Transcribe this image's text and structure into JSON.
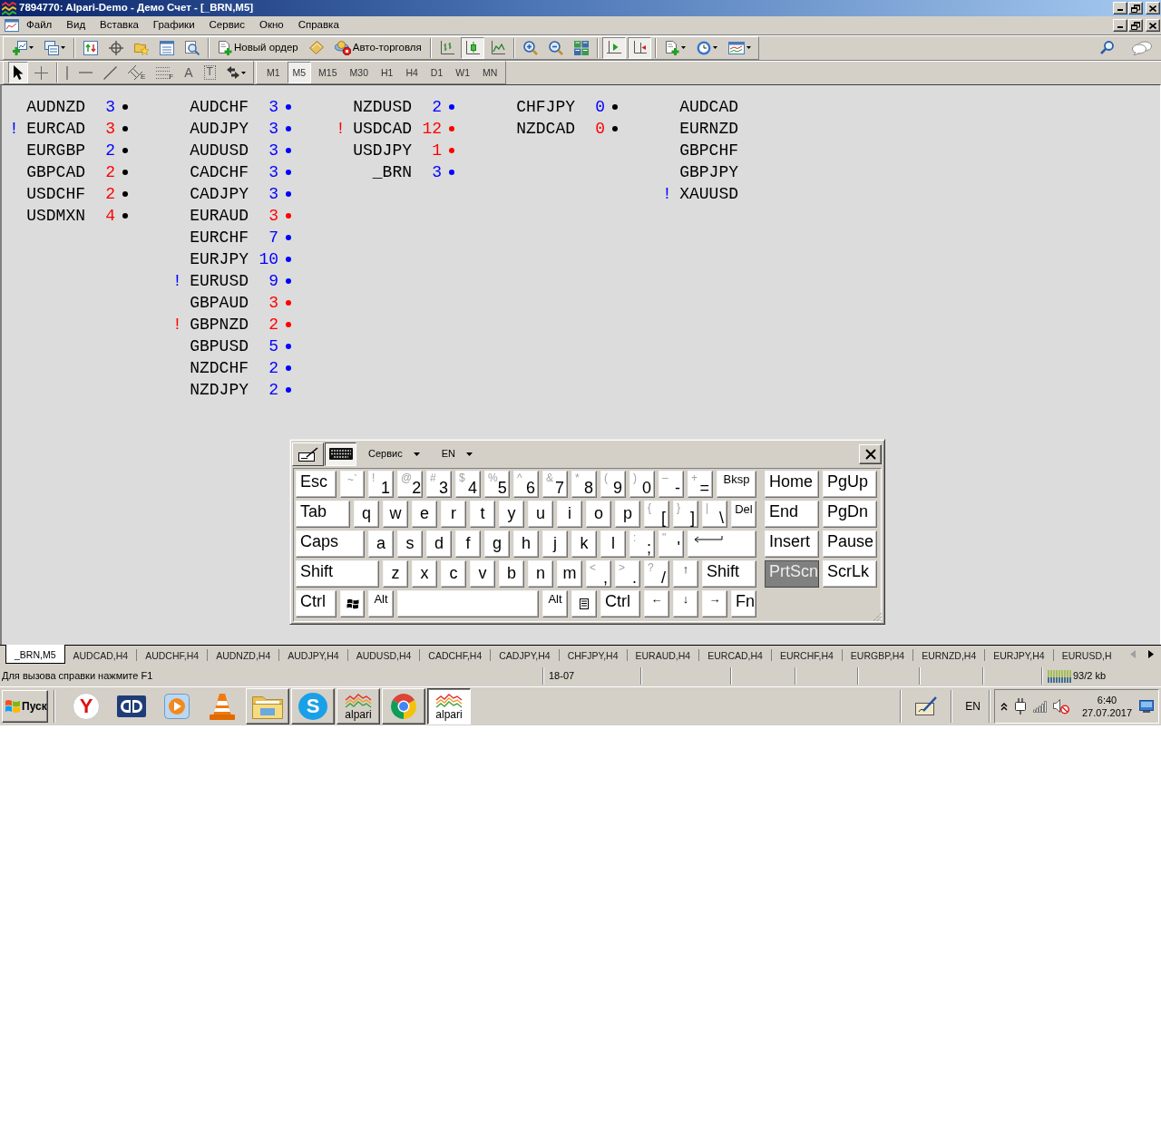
{
  "window": {
    "title": "7894770: Alpari-Demo - Демо Счет - [_BRN,M5]"
  },
  "menu": [
    "Файл",
    "Вид",
    "Вставка",
    "Графики",
    "Сервис",
    "Окно",
    "Справка"
  ],
  "toolbar": {
    "groups": [
      [
        {
          "kind": "new-chart",
          "menu": true,
          "pressed": false
        },
        {
          "kind": "profiles",
          "menu": true,
          "pressed": false
        }
      ],
      [
        {
          "kind": "market-watch",
          "pressed": false
        },
        {
          "kind": "data-window",
          "pressed": false
        },
        {
          "kind": "navigator",
          "pressed": false
        },
        {
          "kind": "terminal",
          "pressed": false
        },
        {
          "kind": "tester",
          "pressed": false
        }
      ],
      [
        {
          "kind": "order",
          "label": "Новый ордер",
          "pressed": false
        },
        {
          "kind": "editor",
          "pressed": false
        },
        {
          "kind": "autotrade",
          "label": "Авто-торговля",
          "pressed": false
        }
      ],
      [
        {
          "kind": "bars",
          "pressed": false
        },
        {
          "kind": "candles",
          "pressed": true
        },
        {
          "kind": "line",
          "pressed": false
        }
      ],
      [
        {
          "kind": "zoom-in",
          "pressed": false
        },
        {
          "kind": "zoom-out",
          "pressed": false
        },
        {
          "kind": "tile",
          "pressed": false
        }
      ],
      [
        {
          "kind": "autoscroll",
          "pressed": true
        },
        {
          "kind": "shift",
          "pressed": true
        }
      ],
      [
        {
          "kind": "indicators",
          "menu": true,
          "pressed": false
        },
        {
          "kind": "periods",
          "menu": true,
          "pressed": false
        },
        {
          "kind": "templates",
          "menu": true,
          "pressed": false
        }
      ]
    ],
    "right": [
      {
        "kind": "search",
        "pressed": false
      },
      {
        "kind": "chat",
        "pressed": false
      }
    ]
  },
  "drawing_tools": {
    "groups": [
      [
        {
          "kind": "cursor",
          "pressed": true
        },
        {
          "kind": "crosshair",
          "pressed": false
        }
      ],
      [
        {
          "kind": "vline",
          "pressed": false
        },
        {
          "kind": "hline",
          "pressed": false
        },
        {
          "kind": "trend",
          "pressed": false
        },
        {
          "kind": "channel",
          "sub": "E",
          "pressed": false
        },
        {
          "kind": "fibo",
          "sub": "F",
          "pressed": false
        },
        {
          "kind": "text",
          "glyph": "A",
          "pressed": false
        },
        {
          "kind": "label",
          "glyph": "T",
          "pressed": false
        },
        {
          "kind": "arrows",
          "menu": true,
          "pressed": false
        }
      ]
    ]
  },
  "timeframes": [
    {
      "label": "M1",
      "selected": false
    },
    {
      "label": "M5",
      "selected": true
    },
    {
      "label": "M15",
      "selected": false
    },
    {
      "label": "M30",
      "selected": false
    },
    {
      "label": "H1",
      "selected": false
    },
    {
      "label": "H4",
      "selected": false
    },
    {
      "label": "D1",
      "selected": false
    },
    {
      "label": "W1",
      "selected": false
    },
    {
      "label": "MN",
      "selected": false
    }
  ],
  "chart": {
    "columns": [
      [
        {
          "symbol": "AUDNZD",
          "count": {
            "text": "3",
            "color": "#0000ff"
          },
          "dot": {
            "color": "#000000"
          }
        },
        {
          "flag": {
            "text": "!",
            "color": "#0000ff"
          },
          "symbol": "EURCAD",
          "count": {
            "text": "3",
            "color": "#ff0000"
          },
          "dot": {
            "color": "#000000"
          }
        },
        {
          "symbol": "EURGBP",
          "count": {
            "text": "2",
            "color": "#0000ff"
          },
          "dot": {
            "color": "#000000"
          }
        },
        {
          "symbol": "GBPCAD",
          "count": {
            "text": "2",
            "color": "#ff0000"
          },
          "dot": {
            "color": "#000000"
          }
        },
        {
          "symbol": "USDCHF",
          "count": {
            "text": "2",
            "color": "#ff0000"
          },
          "dot": {
            "color": "#000000"
          }
        },
        {
          "symbol": "USDMXN",
          "count": {
            "text": "4",
            "color": "#ff0000"
          },
          "dot": {
            "color": "#000000"
          }
        }
      ],
      [
        {
          "symbol": "AUDCHF",
          "count": {
            "text": "3",
            "color": "#0000ff"
          },
          "dot": {
            "color": "#0000ff"
          }
        },
        {
          "symbol": "AUDJPY",
          "count": {
            "text": "3",
            "color": "#0000ff"
          },
          "dot": {
            "color": "#0000ff"
          }
        },
        {
          "symbol": "AUDUSD",
          "count": {
            "text": "3",
            "color": "#0000ff"
          },
          "dot": {
            "color": "#0000ff"
          }
        },
        {
          "symbol": "CADCHF",
          "count": {
            "text": "3",
            "color": "#0000ff"
          },
          "dot": {
            "color": "#0000ff"
          }
        },
        {
          "symbol": "CADJPY",
          "count": {
            "text": "3",
            "color": "#0000ff"
          },
          "dot": {
            "color": "#0000ff"
          }
        },
        {
          "symbol": "EURAUD",
          "count": {
            "text": "3",
            "color": "#ff0000"
          },
          "dot": {
            "color": "#ff0000"
          }
        },
        {
          "symbol": "EURCHF",
          "count": {
            "text": "7",
            "color": "#0000ff"
          },
          "dot": {
            "color": "#0000ff"
          }
        },
        {
          "symbol": "EURJPY",
          "count": {
            "text": "10",
            "color": "#0000ff"
          },
          "dot": {
            "color": "#0000ff"
          }
        },
        {
          "flag": {
            "text": "!",
            "color": "#0000ff"
          },
          "symbol": "EURUSD",
          "count": {
            "text": "9",
            "color": "#0000ff"
          },
          "dot": {
            "color": "#0000ff"
          }
        },
        {
          "symbol": "GBPAUD",
          "count": {
            "text": "3",
            "color": "#ff0000"
          },
          "dot": {
            "color": "#ff0000"
          }
        },
        {
          "flag": {
            "text": "!",
            "color": "#ff0000"
          },
          "symbol": "GBPNZD",
          "count": {
            "text": "2",
            "color": "#ff0000"
          },
          "dot": {
            "color": "#ff0000"
          }
        },
        {
          "symbol": "GBPUSD",
          "count": {
            "text": "5",
            "color": "#0000ff"
          },
          "dot": {
            "color": "#0000ff"
          }
        },
        {
          "symbol": "NZDCHF",
          "count": {
            "text": "2",
            "color": "#0000ff"
          },
          "dot": {
            "color": "#0000ff"
          }
        },
        {
          "symbol": "NZDJPY",
          "count": {
            "text": "2",
            "color": "#0000ff"
          },
          "dot": {
            "color": "#0000ff"
          }
        }
      ],
      [
        {
          "symbol": "NZDUSD",
          "count": {
            "text": "2",
            "color": "#0000ff"
          },
          "dot": {
            "color": "#0000ff"
          }
        },
        {
          "flag": {
            "text": "!",
            "color": "#ff0000"
          },
          "symbol": "USDCAD",
          "count": {
            "text": "12",
            "color": "#ff0000"
          },
          "dot": {
            "color": "#ff0000"
          }
        },
        {
          "symbol": "USDJPY",
          "count": {
            "text": "1",
            "color": "#ff0000"
          },
          "dot": {
            "color": "#ff0000"
          }
        },
        {
          "symbol": "_BRN",
          "count": {
            "text": "3",
            "color": "#0000ff"
          },
          "dot": {
            "color": "#0000ff"
          }
        }
      ],
      [
        {
          "symbol": "CHFJPY",
          "count": {
            "text": "0",
            "color": "#0000ff"
          },
          "dot": {
            "color": "#000000"
          }
        },
        {
          "symbol": "NZDCAD",
          "count": {
            "text": "0",
            "color": "#ff0000"
          },
          "dot": {
            "color": "#000000"
          }
        }
      ],
      [
        {
          "symbol": "AUDCAD"
        },
        {
          "symbol": "EURNZD"
        },
        {
          "symbol": "GBPCHF"
        },
        {
          "symbol": "GBPJPY"
        },
        {
          "flag": {
            "text": "!",
            "color": "#0000ff"
          },
          "symbol": "XAUUSD"
        }
      ]
    ]
  },
  "keyboard": {
    "modes": [
      {
        "kind": "pen",
        "selected": false
      },
      {
        "kind": "keys",
        "selected": true
      }
    ],
    "menus": [
      {
        "label": "Сервис"
      },
      {
        "label": "EN"
      }
    ],
    "rows": [
      [
        {
          "kind": "name",
          "label": "Esc",
          "pressed": false
        },
        {
          "kind": "dim",
          "label": "~`",
          "pressed": false
        },
        {
          "kind": "dual",
          "shift": "!",
          "label": "1",
          "pressed": false
        },
        {
          "kind": "dual",
          "shift": "@",
          "label": "2",
          "pressed": false
        },
        {
          "kind": "dual",
          "shift": "#",
          "label": "3",
          "pressed": false
        },
        {
          "kind": "dual",
          "shift": "$",
          "label": "4",
          "pressed": false
        },
        {
          "kind": "dual",
          "shift": "%",
          "label": "5",
          "pressed": false
        },
        {
          "kind": "dual",
          "shift": "^",
          "label": "6",
          "pressed": false
        },
        {
          "kind": "dual",
          "shift": "&",
          "label": "7",
          "pressed": false
        },
        {
          "kind": "dual",
          "shift": "*",
          "label": "8",
          "pressed": false
        },
        {
          "kind": "dual",
          "shift": "(",
          "label": "9",
          "pressed": false
        },
        {
          "kind": "dual",
          "shift": ")",
          "label": "0",
          "pressed": false
        },
        {
          "kind": "dual",
          "shift": "–",
          "label": "-",
          "pressed": false
        },
        {
          "kind": "dual",
          "shift": "+",
          "label": "=",
          "pressed": false
        },
        {
          "kind": "mini",
          "label": "Bksp",
          "pressed": false
        },
        {
          "kind": "name",
          "label": "Home",
          "pressed": false
        },
        {
          "kind": "name",
          "label": "PgUp",
          "pressed": false
        }
      ],
      [
        {
          "kind": "name",
          "label": "Tab",
          "pressed": false
        },
        {
          "kind": "letter",
          "label": "q",
          "pressed": false
        },
        {
          "kind": "letter",
          "label": "w",
          "pressed": false
        },
        {
          "kind": "letter",
          "label": "e",
          "pressed": false
        },
        {
          "kind": "letter",
          "label": "r",
          "pressed": false
        },
        {
          "kind": "letter",
          "label": "t",
          "pressed": false
        },
        {
          "kind": "letter",
          "label": "y",
          "pressed": false
        },
        {
          "kind": "letter",
          "label": "u",
          "pressed": false
        },
        {
          "kind": "letter",
          "label": "i",
          "pressed": false
        },
        {
          "kind": "letter",
          "label": "o",
          "pressed": false
        },
        {
          "kind": "letter",
          "label": "p",
          "pressed": false
        },
        {
          "kind": "dual",
          "shift": "{",
          "label": "[",
          "pressed": false
        },
        {
          "kind": "dual",
          "shift": "}",
          "label": "]",
          "pressed": false
        },
        {
          "kind": "dual",
          "shift": "|",
          "label": "\\",
          "pressed": false
        },
        {
          "kind": "mini",
          "label": "Del",
          "pressed": false
        },
        {
          "kind": "name",
          "label": "End",
          "pressed": false
        },
        {
          "kind": "name",
          "label": "PgDn",
          "pressed": false
        }
      ],
      [
        {
          "kind": "name",
          "label": "Caps",
          "pressed": false
        },
        {
          "kind": "letter",
          "label": "a",
          "pressed": false
        },
        {
          "kind": "letter",
          "label": "s",
          "pressed": false
        },
        {
          "kind": "letter",
          "label": "d",
          "pressed": false
        },
        {
          "kind": "letter",
          "label": "f",
          "pressed": false
        },
        {
          "kind": "letter",
          "label": "g",
          "pressed": false
        },
        {
          "kind": "letter",
          "label": "h",
          "pressed": false
        },
        {
          "kind": "letter",
          "label": "j",
          "pressed": false
        },
        {
          "kind": "letter",
          "label": "k",
          "pressed": false
        },
        {
          "kind": "letter",
          "label": "l",
          "pressed": false
        },
        {
          "kind": "dual",
          "shift": ":",
          "label": ";",
          "pressed": false
        },
        {
          "kind": "dual",
          "shift": "\"",
          "label": "'",
          "pressed": false
        },
        {
          "kind": "enter",
          "pressed": false
        },
        {
          "kind": "name",
          "label": "Insert",
          "pressed": false
        },
        {
          "kind": "name",
          "label": "Pause",
          "pressed": false
        }
      ],
      [
        {
          "kind": "name",
          "label": "Shift",
          "pressed": false
        },
        {
          "kind": "letter",
          "label": "z",
          "pressed": false
        },
        {
          "kind": "letter",
          "label": "x",
          "pressed": false
        },
        {
          "kind": "letter",
          "label": "c",
          "pressed": false
        },
        {
          "kind": "letter",
          "label": "v",
          "pressed": false
        },
        {
          "kind": "letter",
          "label": "b",
          "pressed": false
        },
        {
          "kind": "letter",
          "label": "n",
          "pressed": false
        },
        {
          "kind": "letter",
          "label": "m",
          "pressed": false
        },
        {
          "kind": "dual",
          "shift": "<",
          "label": ",",
          "pressed": false
        },
        {
          "kind": "dual",
          "shift": ">",
          "label": ".",
          "pressed": false
        },
        {
          "kind": "dual",
          "shift": "?",
          "label": "/",
          "pressed": false
        },
        {
          "kind": "mini",
          "label": "↑",
          "pressed": false
        },
        {
          "kind": "name",
          "label": "Shift",
          "pressed": false
        },
        {
          "kind": "name",
          "label": "PrtScn",
          "pressed": true
        },
        {
          "kind": "name",
          "label": "ScrLk",
          "pressed": false
        }
      ],
      [
        {
          "kind": "name",
          "label": "Ctrl",
          "pressed": false
        },
        {
          "kind": "windows",
          "pressed": false
        },
        {
          "kind": "mini",
          "label": "Alt",
          "pressed": false
        },
        {
          "kind": "space",
          "pressed": false
        },
        {
          "kind": "mini",
          "label": "Alt",
          "pressed": false
        },
        {
          "kind": "menu",
          "pressed": false
        },
        {
          "kind": "name",
          "label": "Ctrl",
          "pressed": false
        },
        {
          "kind": "mini",
          "label": "←",
          "pressed": false
        },
        {
          "kind": "mini",
          "label": "↓",
          "pressed": false
        },
        {
          "kind": "mini",
          "label": "→",
          "pressed": false
        },
        {
          "kind": "name",
          "label": "Fn",
          "pressed": false
        }
      ]
    ]
  },
  "tabs": [
    {
      "label": "_BRN,M5",
      "selected": true
    },
    {
      "label": "AUDCAD,H4",
      "selected": false
    },
    {
      "label": "AUDCHF,H4",
      "selected": false
    },
    {
      "label": "AUDNZD,H4",
      "selected": false
    },
    {
      "label": "AUDJPY,H4",
      "selected": false
    },
    {
      "label": "AUDUSD,H4",
      "selected": false
    },
    {
      "label": "CADCHF,H4",
      "selected": false
    },
    {
      "label": "CADJPY,H4",
      "selected": false
    },
    {
      "label": "CHFJPY,H4",
      "selected": false
    },
    {
      "label": "EURAUD,H4",
      "selected": false
    },
    {
      "label": "EURCAD,H4",
      "selected": false
    },
    {
      "label": "EURCHF,H4",
      "selected": false
    },
    {
      "label": "EURGBP,H4",
      "selected": false
    },
    {
      "label": "EURNZD,H4",
      "selected": false
    },
    {
      "label": "EURJPY,H4",
      "selected": false
    },
    {
      "label": "EURUSD,H",
      "selected": false
    }
  ],
  "tab_scroll": [
    {
      "kind": "left",
      "disabled": true
    },
    {
      "kind": "right",
      "disabled": false
    }
  ],
  "status_bar": {
    "help": "Для вызова справки нажмите F1",
    "panels": [
      "18-07"
    ],
    "traffic": "93/2 kb"
  },
  "taskbar": {
    "start": "Пуск",
    "apps": [
      {
        "kind": "letter-circle",
        "glyph": "Y",
        "running": false,
        "selected": false
      },
      {
        "kind": "dd",
        "running": false,
        "selected": false
      },
      {
        "kind": "player",
        "running": false,
        "selected": false
      },
      {
        "kind": "cone",
        "running": false,
        "selected": false
      },
      {
        "kind": "folder",
        "running": true,
        "selected": false
      },
      {
        "kind": "letter-cloud",
        "glyph": "S",
        "running": true,
        "selected": false
      },
      {
        "kind": "zigzag",
        "caption": "alpari",
        "running": true,
        "selected": false
      },
      {
        "kind": "chrome",
        "running": true,
        "selected": false
      },
      {
        "kind": "zigzag",
        "caption": "alpari",
        "running": true,
        "selected": true
      }
    ],
    "language": "EN",
    "tray": [
      {
        "kind": "chevron"
      },
      {
        "kind": "plug"
      },
      {
        "kind": "signal"
      },
      {
        "kind": "speaker",
        "muted": true
      }
    ],
    "time": "6:40",
    "date": "27.07.2017"
  }
}
